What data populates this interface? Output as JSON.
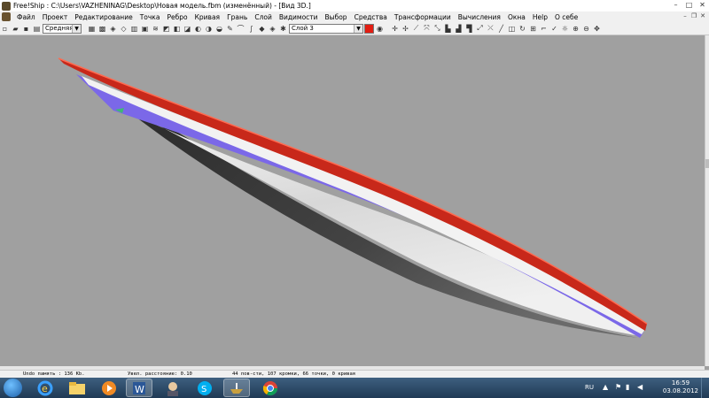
{
  "window": {
    "title": "Free!Ship  : C:\\Users\\VAZHENINAG\\Desktop\\Новая модель.fbm (изменённый) - [Вид 3D.]"
  },
  "menu": {
    "items": [
      "Файл",
      "Проект",
      "Редактирование",
      "Точка",
      "Ребро",
      "Кривая",
      "Грань",
      "Слой",
      "Видимости",
      "Выбор",
      "Средства",
      "Трансформации",
      "Вычисления",
      "Окна",
      "Help",
      "О себе"
    ]
  },
  "toolbar": {
    "precision_select": "Средняя",
    "layer_select": "Слой 3",
    "layer_color": "#e21d12"
  },
  "statusbar": {
    "undo": "Undo память : 136 Kb.",
    "distance": "Увел. расстояние: 0.10",
    "counts": "44 пов-сти, 107 кромки, 66 точки, 0 кривая"
  },
  "taskbar": {
    "language": "RU",
    "time": "16:59",
    "date": "03.08.2012"
  },
  "hull": {
    "deck_color": "#c8281a",
    "side_color": "#7b68e8",
    "bottom_light": "#f4f4f4",
    "bottom_dark": "#3a3a3a"
  }
}
